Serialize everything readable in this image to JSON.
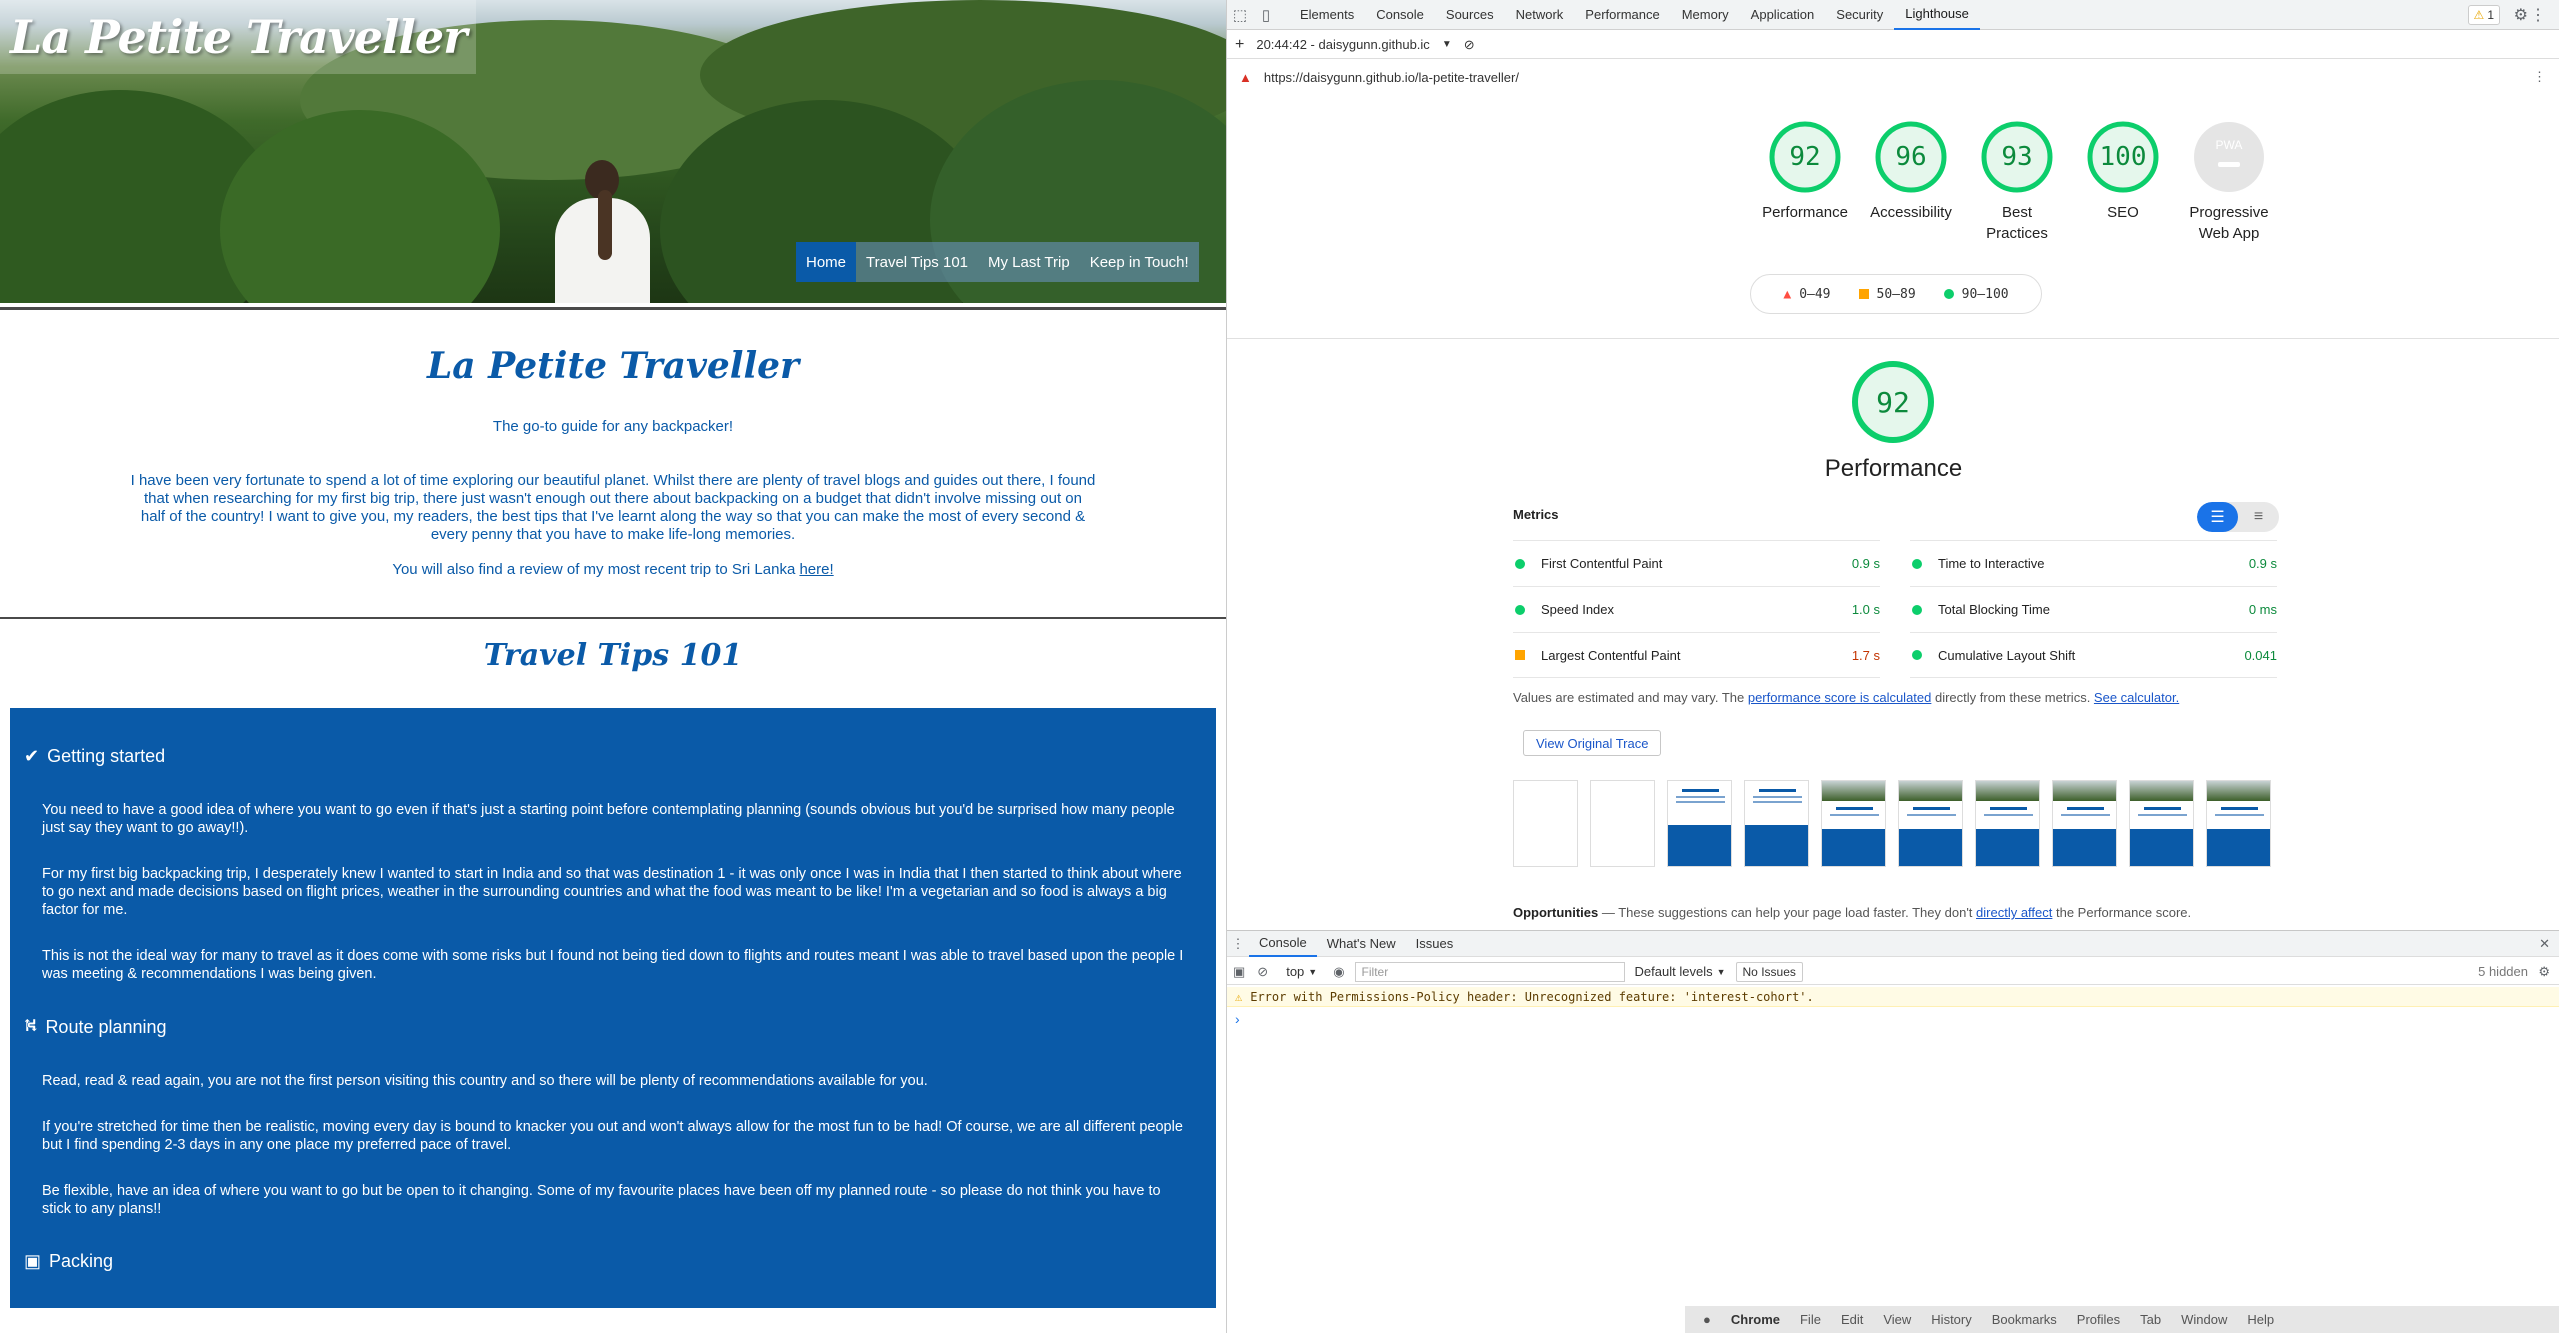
{
  "site": {
    "brand": "La Petite Traveller",
    "nav": [
      "Home",
      "Travel Tips 101",
      "My Last Trip",
      "Keep in Touch!"
    ],
    "title": "La Petite Traveller",
    "tagline": "The go-to guide for any backpacker!",
    "intro": "I have been very fortunate to spend a lot of time exploring our beautiful planet. Whilst there are plenty of travel blogs and guides out there, I found that when researching for my first big trip, there just wasn't enough out there about backpacking on a budget that didn't involve missing out on half of the country! I want to give you, my readers, the best tips that I've learnt along the way so that you can make the most of every second & every penny that you have to make life-long memories.",
    "also_text": "You will also find a review of my most recent trip to Sri Lanka ",
    "also_link": "here!",
    "tips_title": "Travel Tips 101",
    "tips": {
      "h1": "Getting started",
      "p1": "You need to have a good idea of where you want to go even if that's just a starting point before contemplating planning (sounds obvious but you'd be surprised how many people just say they want to go away!!).",
      "p2": "For my first big backpacking trip, I desperately knew I wanted to start in India and so that was destination 1 - it was only once I was in India that I then started to think about where to go next and made decisions based on flight prices, weather in the surrounding countries and what the food was meant to be like! I'm a vegetarian and so food is always a big factor for me.",
      "p3": "This is not the ideal way for many to travel as it does come with some risks but I found not being tied down to flights and routes meant I was able to travel based upon the people I was meeting & recommendations I was being given.",
      "h2": "Route planning",
      "p4": "Read, read & read again, you are not the first person visiting this country and so there will be plenty of recommendations available for you.",
      "p5": "If you're stretched for time then be realistic, moving every day is bound to knacker you out and won't always allow for the most fun to be had! Of course, we are all different people but I find spending 2-3 days in any one place my preferred pace of travel.",
      "p6": "Be flexible, have an idea of where you want to go but be open to it changing. Some of my favourite places have been off my planned route - so please do not think you have to stick to any plans!!",
      "h3": "Packing"
    }
  },
  "devtools": {
    "tabs": [
      "Elements",
      "Console",
      "Sources",
      "Network",
      "Performance",
      "Memory",
      "Application",
      "Security",
      "Lighthouse"
    ],
    "warn_count": "1",
    "report_time": "20:44:42 - daisygunn.github.ic",
    "url": "https://daisygunn.github.io/la-petite-traveller/",
    "scores": [
      {
        "label": "Performance",
        "value": "92"
      },
      {
        "label": "Accessibility",
        "value": "96"
      },
      {
        "label": "Best Practices",
        "value": "93"
      },
      {
        "label": "SEO",
        "value": "100"
      },
      {
        "label": "Progressive Web App",
        "value": "PWA"
      }
    ],
    "legend": [
      "0–49",
      "50–89",
      "90–100"
    ],
    "perf_score": "92",
    "perf_title": "Performance",
    "metrics_heading": "Metrics",
    "metrics": [
      {
        "name": "First Contentful Paint",
        "value": "0.9 s"
      },
      {
        "name": "Time to Interactive",
        "value": "0.9 s"
      },
      {
        "name": "Speed Index",
        "value": "1.0 s"
      },
      {
        "name": "Total Blocking Time",
        "value": "0 ms"
      },
      {
        "name": "Largest Contentful Paint",
        "value": "1.7 s"
      },
      {
        "name": "Cumulative Layout Shift",
        "value": "0.041"
      }
    ],
    "note_a": "Values are estimated and may vary. The ",
    "note_link1": "performance score is calculated",
    "note_b": " directly from these metrics. ",
    "note_link2": "See calculator.",
    "trace_btn": "View Original Trace",
    "opps_title": "Opportunities",
    "opps_a": " — These suggestions can help your page load faster. They don't ",
    "opps_link": "directly affect",
    "opps_b": " the Performance score.",
    "drawer_tabs": [
      "Console",
      "What's New",
      "Issues"
    ],
    "context": "top",
    "filter_placeholder": "Filter",
    "levels": "Default levels",
    "no_issues": "No Issues",
    "hidden": "5 hidden",
    "error": "Error with Permissions-Policy header: Unrecognized feature: 'interest-cohort'."
  },
  "macbar": [
    "Chrome",
    "File",
    "Edit",
    "View",
    "History",
    "Bookmarks",
    "Profiles",
    "Tab",
    "Window",
    "Help"
  ]
}
